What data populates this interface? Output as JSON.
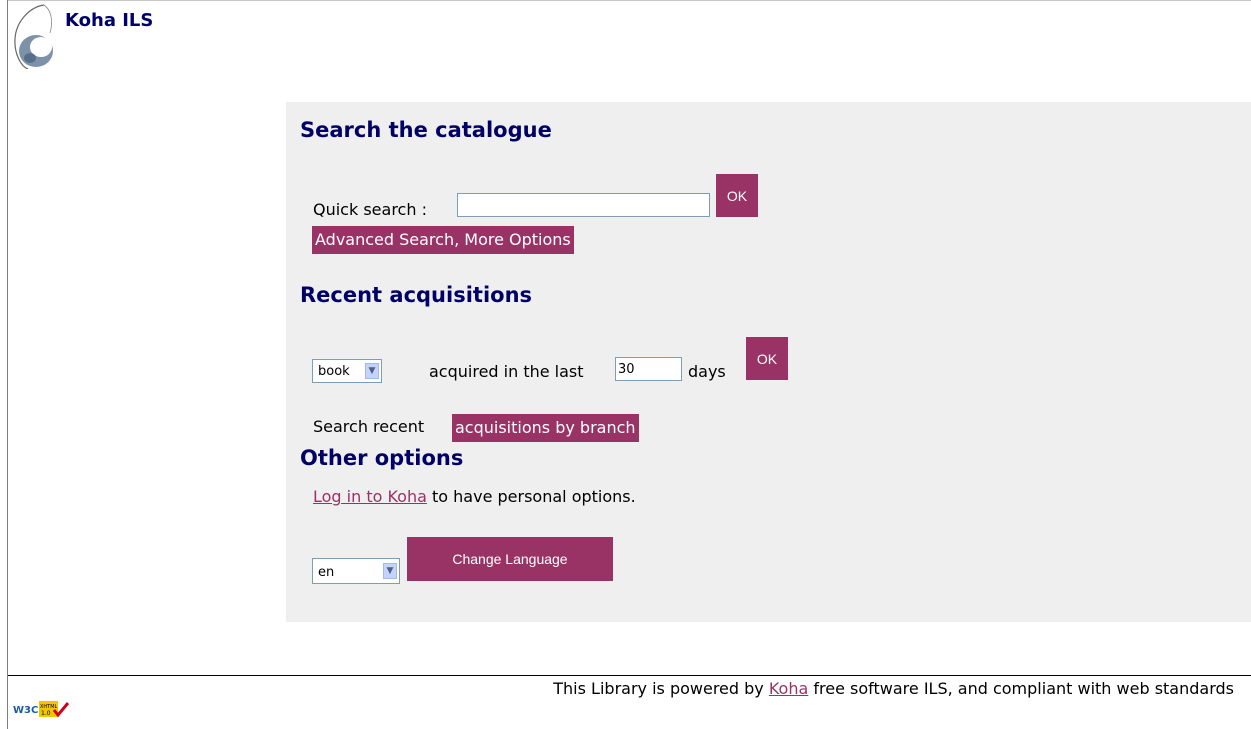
{
  "site": {
    "title": "Koha ILS"
  },
  "search": {
    "heading": "Search the catalogue",
    "quick_search_label": "Quick search :",
    "quick_search_value": "",
    "ok_label": "OK",
    "advanced_label": "Advanced Search, More Options"
  },
  "acquisitions": {
    "heading": "Recent acquisitions",
    "type_value": "book",
    "acquired_label": "acquired in the last",
    "days_value": "30",
    "days_label": "days",
    "ok_label": "OK",
    "by_branch_prefix": "Search recent",
    "by_branch_link": "acquisitions by branch"
  },
  "other": {
    "heading": "Other options",
    "login_link": "Log in to Koha",
    "login_suffix": "to have personal options.",
    "language_value": "en",
    "change_language_label": "Change Language"
  },
  "footer": {
    "prefix": "This Library is powered by",
    "link": "Koha",
    "suffix": "free software ILS, and compliant with web standards"
  },
  "badge": {
    "w3c": "W3C",
    "xhtml": "XHTML",
    "version": "1.0"
  },
  "colors": {
    "accent": "#993366",
    "heading": "#000066",
    "panel": "#efefef"
  }
}
